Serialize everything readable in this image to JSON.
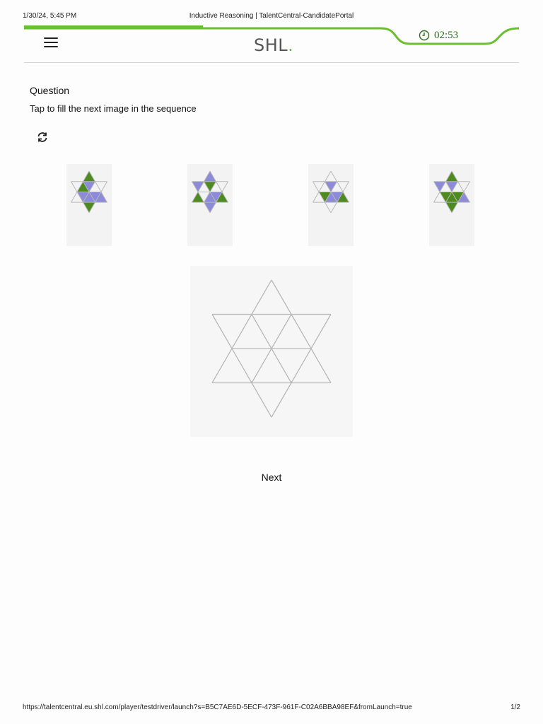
{
  "print_header": {
    "datetime": "1/30/24, 5:45 PM",
    "page_title": "Inductive Reasoning | TalentCentral-CandidatePortal"
  },
  "topbar": {
    "logo_text": "SHL",
    "logo_dot": ".",
    "timer": "02:53",
    "menu_icon": "hamburger-icon",
    "timer_icon": "clock-icon",
    "progress_fraction": 0.27
  },
  "question": {
    "heading": "Question",
    "instruction": "Tap to fill the next image in the sequence",
    "reset_icon": "refresh-icon"
  },
  "sequence": [
    {
      "cells": {
        "top": "G",
        "ul": "",
        "ur": "",
        "cl": "P",
        "cc": "P",
        "cr": "P",
        "ml": "G",
        "mr": "",
        "bl": "",
        "bc": "P",
        "br": "P",
        "bottom": "G"
      }
    },
    {
      "cells": {
        "top": "P",
        "ul": "P",
        "ur": "",
        "cl": "G",
        "cc": "",
        "cr": "P",
        "ml": "",
        "mr": "",
        "bl": "G",
        "bc": "P",
        "br": "G",
        "bottom": "P"
      }
    },
    {
      "cells": {
        "top": "",
        "ul": "",
        "ur": "",
        "cl": "P",
        "cc": "G",
        "cr": "P",
        "ml": "",
        "mr": "",
        "bl": "",
        "bc": "P",
        "br": "G",
        "bottom": ""
      }
    },
    {
      "cells": {
        "top": "G",
        "ul": "P",
        "ur": "",
        "cl": "P",
        "cc": "G",
        "cr": "G",
        "ml": "",
        "mr": "",
        "bl": "",
        "bc": "G",
        "br": "P",
        "bottom": "G"
      }
    }
  ],
  "answer_grid": {
    "state": "empty"
  },
  "colors": {
    "green": "#4e8a1f",
    "purple": "#8d8bd9",
    "accent": "#6abf2e",
    "line": "#b8b8b8"
  },
  "next_label": "Next",
  "print_footer": {
    "url": "https://talentcentral.eu.shl.com/player/testdriver/launch?s=B5C7AE6D-5ECF-473F-961F-C02A6BBA98EF&fromLaunch=true",
    "page": "1/2"
  }
}
